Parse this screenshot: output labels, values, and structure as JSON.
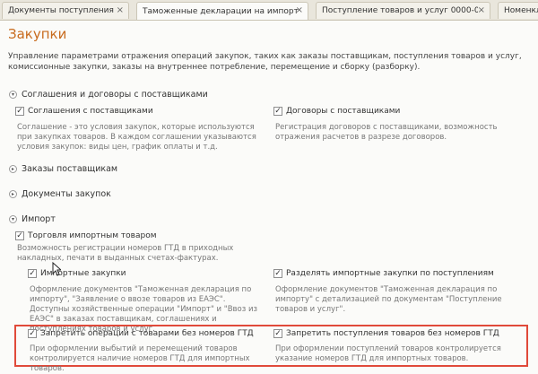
{
  "tabs": [
    {
      "label": "Документы поступления"
    },
    {
      "label": "Таможенные декларации на импорт"
    },
    {
      "label": "Поступление товаров и услуг 0000-000..."
    },
    {
      "label": "Номенкл"
    }
  ],
  "tab_close_glyph": "×",
  "page": {
    "title": "Закупки",
    "description": "Управление параметрами отражения операций закупок, таких как заказы поставщикам, поступления товаров и услуг, комиссионные закупки, заказы на внутреннее потребление, перемещение и сборку (разборку)."
  },
  "sections": {
    "agreements": {
      "title": "Соглашения и договоры с поставщиками",
      "left": {
        "label": "Соглашения с поставщиками",
        "checked": true,
        "note": "Соглашение - это условия закупок, которые используются при закупках товаров. В каждом соглашении указываются условия закупок: виды цен, график оплаты и т.д."
      },
      "right": {
        "label": "Договоры с поставщиками",
        "checked": true,
        "note": "Регистрация договоров с поставщиками, возможность отражения расчетов в разрезе договоров."
      }
    },
    "orders": {
      "title": "Заказы поставщикам"
    },
    "purchase_docs": {
      "title": "Документы закупок"
    },
    "import": {
      "title": "Импорт",
      "trade": {
        "label": "Торговля импортным товаром",
        "checked": true,
        "note": "Возможность регистрации номеров ГТД в приходных накладных, печати в выданных счетах-фактурах."
      },
      "import_purchases": {
        "label": "Импортные закупки",
        "checked": true,
        "note": "Оформление документов \"Таможенная декларация по импорту\", \"Заявление о ввозе товаров из ЕАЭС\". Доступны хозяйственные операции \"Импорт\" и \"Ввоз из ЕАЭС\" в заказах поставщикам, соглашениях и поступлениях товаров и услуг."
      },
      "split": {
        "label": "Разделять импортные закупки по поступлениям",
        "checked": true,
        "note": "Оформление документов \"Таможенная декларация по импорту\" с детализацией по документам \"Поступление товаров и услуг\"."
      },
      "forbid_ops": {
        "label": "Запретить операции с товарами без номеров ГТД",
        "checked": true,
        "note": "При оформлении выбытий и перемещений товаров контролируется наличие номеров ГТД для импортных товаров."
      },
      "forbid_receipts": {
        "label": "Запретить поступления товаров без номеров ГТД",
        "checked": true,
        "note": "При оформлении поступлений товаров контролируется указание номеров ГТД для импортных товаров."
      }
    }
  },
  "glyphs": {
    "check": "✓",
    "expanded": "▾",
    "collapsed": "▸"
  },
  "colors": {
    "title": "#c86b1e",
    "highlight": "#e04a3a"
  }
}
